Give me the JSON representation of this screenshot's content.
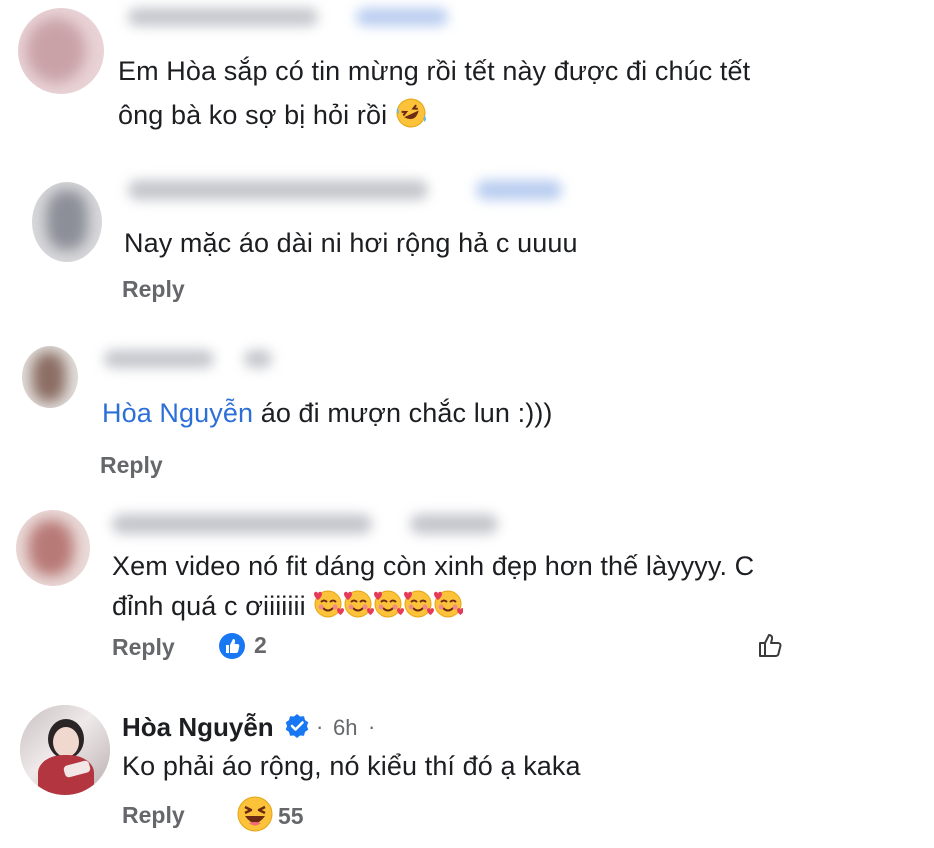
{
  "comments": [
    {
      "text_line1": "Em Hòa sắp có tin mừng rồi tết này được đi chúc tết",
      "text_line2": "ông bà ko sợ bị hỏi rồi",
      "emoji_icon": "rolling-on-floor-laughing-icon"
    },
    {
      "text": "Nay mặc áo dài ni hơi rộng hả c uuuu",
      "reply_label": "Reply"
    },
    {
      "mention": "Hòa Nguyễn",
      "text": "áo đi mượn chắc lun :)))",
      "reply_label": "Reply"
    },
    {
      "text_line1": "Xem video nó fit dáng còn xinh đẹp hơn thế làyyyy. C",
      "text_line2": "đỉnh quá c ơiiiiiii",
      "emoji_icon": "smiling-face-with-hearts-icon",
      "emoji_count": 5,
      "reply_label": "Reply",
      "like_count": "2"
    },
    {
      "author": "Hòa Nguyễn",
      "verified": true,
      "time": "6h",
      "separator": "·",
      "text": "Ko phải áo rộng, nó kiểu thí đó ạ kaka",
      "reply_label": "Reply",
      "reaction_icon": "grinning-squinting-face-icon",
      "reaction_count": "55"
    }
  ],
  "colors": {
    "link": "#2d6fd8",
    "muted": "#65676b",
    "like_blue": "#1877f2"
  }
}
